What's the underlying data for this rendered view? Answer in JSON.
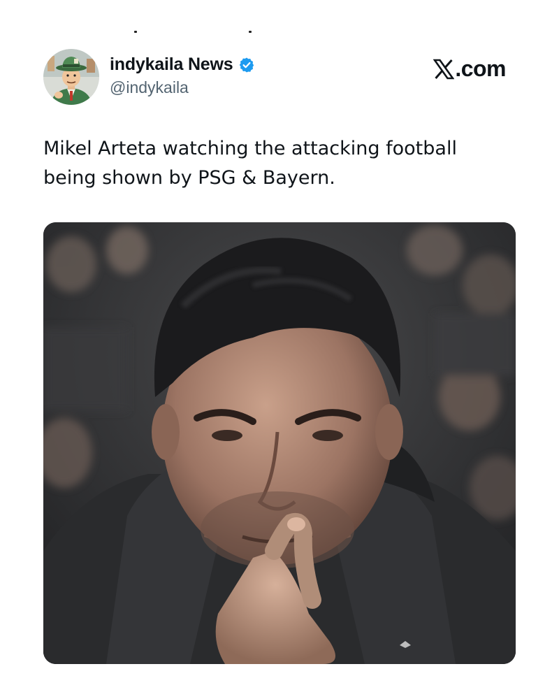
{
  "header": {
    "display_name": "indykaila News",
    "handle": "@indykaila",
    "verified_icon": "verified-badge-icon",
    "avatar_icon": "cartoon-avatar-icon"
  },
  "brand": {
    "logo_icon": "x-logo-icon",
    "text": ".com"
  },
  "tweet": {
    "text": "Mikel Arteta watching the attacking football\nbeing shown by PSG & Bayern."
  },
  "media": {
    "image_icon": "photo-man-finger-to-lips"
  },
  "colors": {
    "text_primary": "#0f1419",
    "text_secondary": "#536471",
    "verified_blue": "#1d9bf0"
  }
}
